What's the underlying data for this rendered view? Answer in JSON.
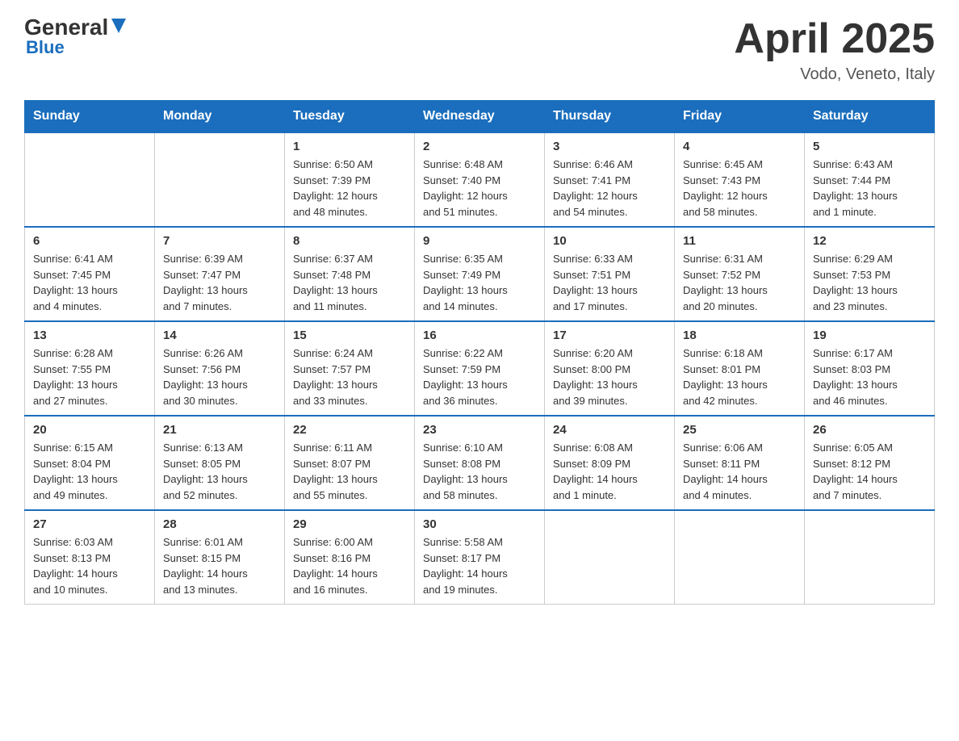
{
  "header": {
    "logo_line1": "General",
    "logo_line2": "Blue",
    "month_title": "April 2025",
    "location": "Vodo, Veneto, Italy"
  },
  "days_of_week": [
    "Sunday",
    "Monday",
    "Tuesday",
    "Wednesday",
    "Thursday",
    "Friday",
    "Saturday"
  ],
  "weeks": [
    [
      {
        "day": "",
        "info": ""
      },
      {
        "day": "",
        "info": ""
      },
      {
        "day": "1",
        "info": "Sunrise: 6:50 AM\nSunset: 7:39 PM\nDaylight: 12 hours\nand 48 minutes."
      },
      {
        "day": "2",
        "info": "Sunrise: 6:48 AM\nSunset: 7:40 PM\nDaylight: 12 hours\nand 51 minutes."
      },
      {
        "day": "3",
        "info": "Sunrise: 6:46 AM\nSunset: 7:41 PM\nDaylight: 12 hours\nand 54 minutes."
      },
      {
        "day": "4",
        "info": "Sunrise: 6:45 AM\nSunset: 7:43 PM\nDaylight: 12 hours\nand 58 minutes."
      },
      {
        "day": "5",
        "info": "Sunrise: 6:43 AM\nSunset: 7:44 PM\nDaylight: 13 hours\nand 1 minute."
      }
    ],
    [
      {
        "day": "6",
        "info": "Sunrise: 6:41 AM\nSunset: 7:45 PM\nDaylight: 13 hours\nand 4 minutes."
      },
      {
        "day": "7",
        "info": "Sunrise: 6:39 AM\nSunset: 7:47 PM\nDaylight: 13 hours\nand 7 minutes."
      },
      {
        "day": "8",
        "info": "Sunrise: 6:37 AM\nSunset: 7:48 PM\nDaylight: 13 hours\nand 11 minutes."
      },
      {
        "day": "9",
        "info": "Sunrise: 6:35 AM\nSunset: 7:49 PM\nDaylight: 13 hours\nand 14 minutes."
      },
      {
        "day": "10",
        "info": "Sunrise: 6:33 AM\nSunset: 7:51 PM\nDaylight: 13 hours\nand 17 minutes."
      },
      {
        "day": "11",
        "info": "Sunrise: 6:31 AM\nSunset: 7:52 PM\nDaylight: 13 hours\nand 20 minutes."
      },
      {
        "day": "12",
        "info": "Sunrise: 6:29 AM\nSunset: 7:53 PM\nDaylight: 13 hours\nand 23 minutes."
      }
    ],
    [
      {
        "day": "13",
        "info": "Sunrise: 6:28 AM\nSunset: 7:55 PM\nDaylight: 13 hours\nand 27 minutes."
      },
      {
        "day": "14",
        "info": "Sunrise: 6:26 AM\nSunset: 7:56 PM\nDaylight: 13 hours\nand 30 minutes."
      },
      {
        "day": "15",
        "info": "Sunrise: 6:24 AM\nSunset: 7:57 PM\nDaylight: 13 hours\nand 33 minutes."
      },
      {
        "day": "16",
        "info": "Sunrise: 6:22 AM\nSunset: 7:59 PM\nDaylight: 13 hours\nand 36 minutes."
      },
      {
        "day": "17",
        "info": "Sunrise: 6:20 AM\nSunset: 8:00 PM\nDaylight: 13 hours\nand 39 minutes."
      },
      {
        "day": "18",
        "info": "Sunrise: 6:18 AM\nSunset: 8:01 PM\nDaylight: 13 hours\nand 42 minutes."
      },
      {
        "day": "19",
        "info": "Sunrise: 6:17 AM\nSunset: 8:03 PM\nDaylight: 13 hours\nand 46 minutes."
      }
    ],
    [
      {
        "day": "20",
        "info": "Sunrise: 6:15 AM\nSunset: 8:04 PM\nDaylight: 13 hours\nand 49 minutes."
      },
      {
        "day": "21",
        "info": "Sunrise: 6:13 AM\nSunset: 8:05 PM\nDaylight: 13 hours\nand 52 minutes."
      },
      {
        "day": "22",
        "info": "Sunrise: 6:11 AM\nSunset: 8:07 PM\nDaylight: 13 hours\nand 55 minutes."
      },
      {
        "day": "23",
        "info": "Sunrise: 6:10 AM\nSunset: 8:08 PM\nDaylight: 13 hours\nand 58 minutes."
      },
      {
        "day": "24",
        "info": "Sunrise: 6:08 AM\nSunset: 8:09 PM\nDaylight: 14 hours\nand 1 minute."
      },
      {
        "day": "25",
        "info": "Sunrise: 6:06 AM\nSunset: 8:11 PM\nDaylight: 14 hours\nand 4 minutes."
      },
      {
        "day": "26",
        "info": "Sunrise: 6:05 AM\nSunset: 8:12 PM\nDaylight: 14 hours\nand 7 minutes."
      }
    ],
    [
      {
        "day": "27",
        "info": "Sunrise: 6:03 AM\nSunset: 8:13 PM\nDaylight: 14 hours\nand 10 minutes."
      },
      {
        "day": "28",
        "info": "Sunrise: 6:01 AM\nSunset: 8:15 PM\nDaylight: 14 hours\nand 13 minutes."
      },
      {
        "day": "29",
        "info": "Sunrise: 6:00 AM\nSunset: 8:16 PM\nDaylight: 14 hours\nand 16 minutes."
      },
      {
        "day": "30",
        "info": "Sunrise: 5:58 AM\nSunset: 8:17 PM\nDaylight: 14 hours\nand 19 minutes."
      },
      {
        "day": "",
        "info": ""
      },
      {
        "day": "",
        "info": ""
      },
      {
        "day": "",
        "info": ""
      }
    ]
  ]
}
